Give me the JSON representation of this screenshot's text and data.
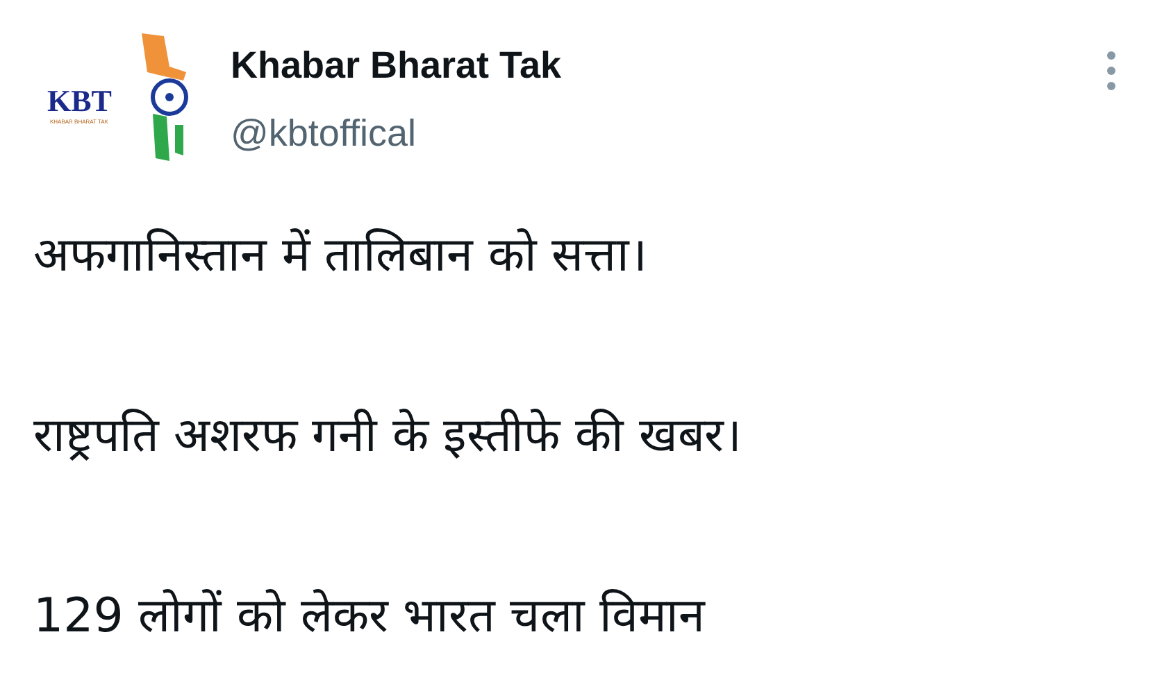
{
  "author": {
    "name": "Khabar Bharat Tak",
    "handle": "@kbtoffical",
    "avatar": {
      "logo_text": "KBT",
      "logo_subtext": "KHABAR BHARAT TAK"
    }
  },
  "tweet": {
    "lines": [
      "अफगानिस्तान में तालिबान को सत्ता।",
      "राष्ट्रपति अशरफ गनी के इस्तीफे की खबर।",
      "129 लोगों को लेकर भारत चला विमान"
    ]
  }
}
